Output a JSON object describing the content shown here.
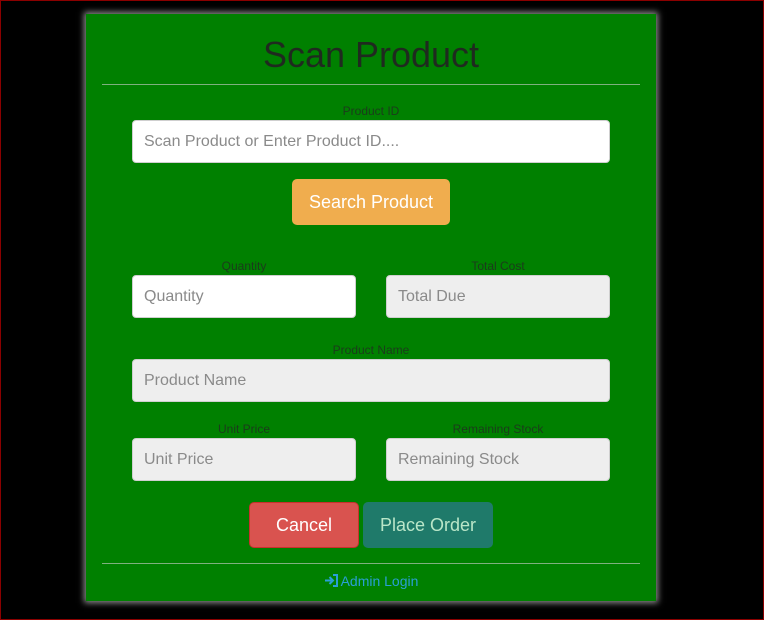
{
  "header": {
    "title": "Scan Product"
  },
  "product_id": {
    "label": "Product ID",
    "placeholder": "Scan Product or Enter Product ID...."
  },
  "search_button": {
    "label": "Search Product"
  },
  "quantity": {
    "label": "Quantity",
    "placeholder": "Quantity"
  },
  "total_cost": {
    "label": "Total Cost",
    "placeholder": "Total Due"
  },
  "product_name": {
    "label": "Product Name",
    "placeholder": "Product Name"
  },
  "unit_price": {
    "label": "Unit Price",
    "placeholder": "Unit Price"
  },
  "remaining_stock": {
    "label": "Remaining Stock",
    "placeholder": "Remaining Stock"
  },
  "actions": {
    "cancel_label": "Cancel",
    "place_order_label": "Place Order"
  },
  "footer": {
    "admin_login_label": "Admin Login",
    "admin_icon": "sign-in-icon"
  },
  "colors": {
    "panel": "#008000",
    "search": "#f0ad4e",
    "cancel": "#d9534f",
    "place_order": "#1f7a6a",
    "link": "#2a9fd6"
  }
}
